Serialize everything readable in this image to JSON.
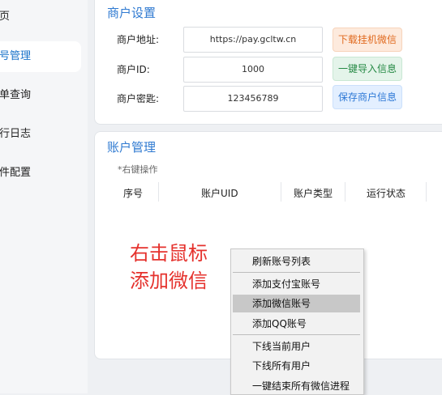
{
  "sidebar": {
    "items": [
      {
        "label": "首页"
      },
      {
        "label": "账号管理"
      },
      {
        "label": "订单查询"
      },
      {
        "label": "运行日志"
      },
      {
        "label": "软件配置"
      }
    ]
  },
  "merchant": {
    "title": "商户设置",
    "address_label": "商户地址:",
    "address_value": "https://pay.gcltw.cn",
    "id_label": "商户ID:",
    "id_value": "1000",
    "key_label": "商户密匙:",
    "key_value": "123456789",
    "download_button": "下载挂机微信",
    "import_button": "一键导入信息",
    "save_button": "保存商户信息"
  },
  "accounts": {
    "title": "账户管理",
    "note": "*右键操作",
    "columns": [
      "序号",
      "账户UID",
      "账户类型",
      "运行状态"
    ]
  },
  "hint": {
    "line1": "右击鼠标",
    "line2": "添加微信"
  },
  "context_menu": {
    "items": [
      {
        "label": "刷新账号列表"
      },
      {
        "label": "添加支付宝账号"
      },
      {
        "label": "添加微信账号"
      },
      {
        "label": "添加QQ账号"
      },
      {
        "label": "下线当前用户"
      },
      {
        "label": "下线所有用户"
      },
      {
        "label": "一键结束所有微信进程"
      }
    ]
  }
}
